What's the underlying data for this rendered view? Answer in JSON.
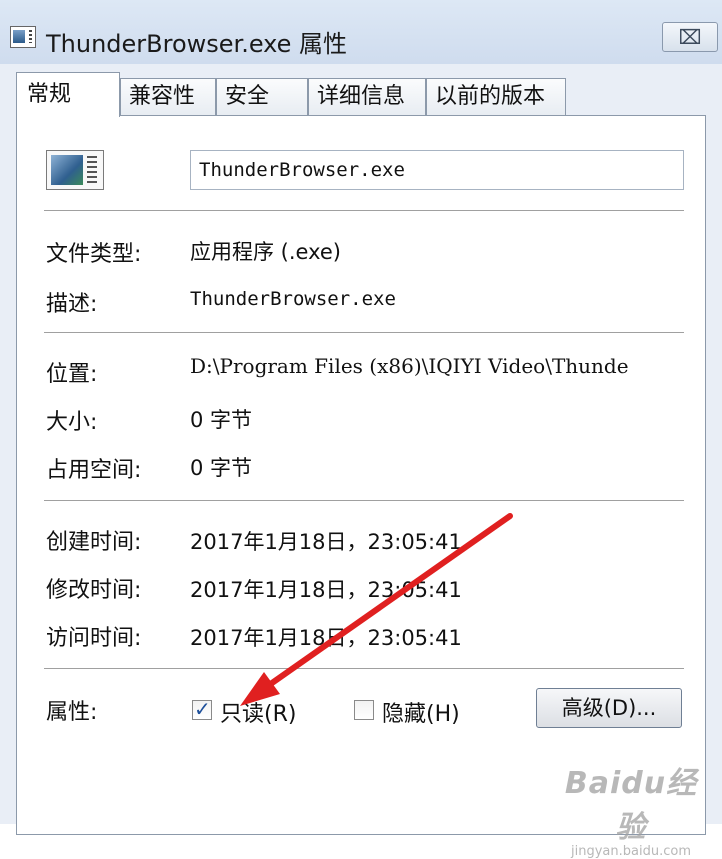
{
  "window": {
    "title": "ThunderBrowser.exe 属性",
    "close_glyph": "⌧",
    "close_icon": "close-icon",
    "app_icon": "exe-file-icon"
  },
  "tabs": [
    {
      "label": "常规",
      "active": true
    },
    {
      "label": "兼容性",
      "active": false
    },
    {
      "label": "安全",
      "active": false
    },
    {
      "label": "详细信息",
      "active": false
    },
    {
      "label": "以前的版本",
      "active": false
    }
  ],
  "general": {
    "file_name": "ThunderBrowser.exe",
    "file_type_label": "文件类型:",
    "file_type_value": "应用程序 (.exe)",
    "description_label": "描述:",
    "description_value": "ThunderBrowser.exe",
    "location_label": "位置:",
    "location_value": "D:\\Program Files (x86)\\IQIYI Video\\Thunde",
    "size_label": "大小:",
    "size_value": "0 字节",
    "disk_size_label": "占用空间:",
    "disk_size_value": "0 字节",
    "created_label": "创建时间:",
    "created_value": "2017年1月18日，23:05:41",
    "modified_label": "修改时间:",
    "modified_value": "2017年1月18日，23:05:41",
    "accessed_label": "访问时间:",
    "accessed_value": "2017年1月18日，23:05:41",
    "attributes_label": "属性:",
    "readonly_label": "只读(R)",
    "readonly_checked": true,
    "hidden_label": "隐藏(H)",
    "hidden_checked": false,
    "advanced_button": "高级(D)..."
  },
  "annotation": {
    "arrow_color": "#e02020"
  },
  "watermark": {
    "brand": "Baidu经验",
    "url": "jingyan.baidu.com"
  }
}
